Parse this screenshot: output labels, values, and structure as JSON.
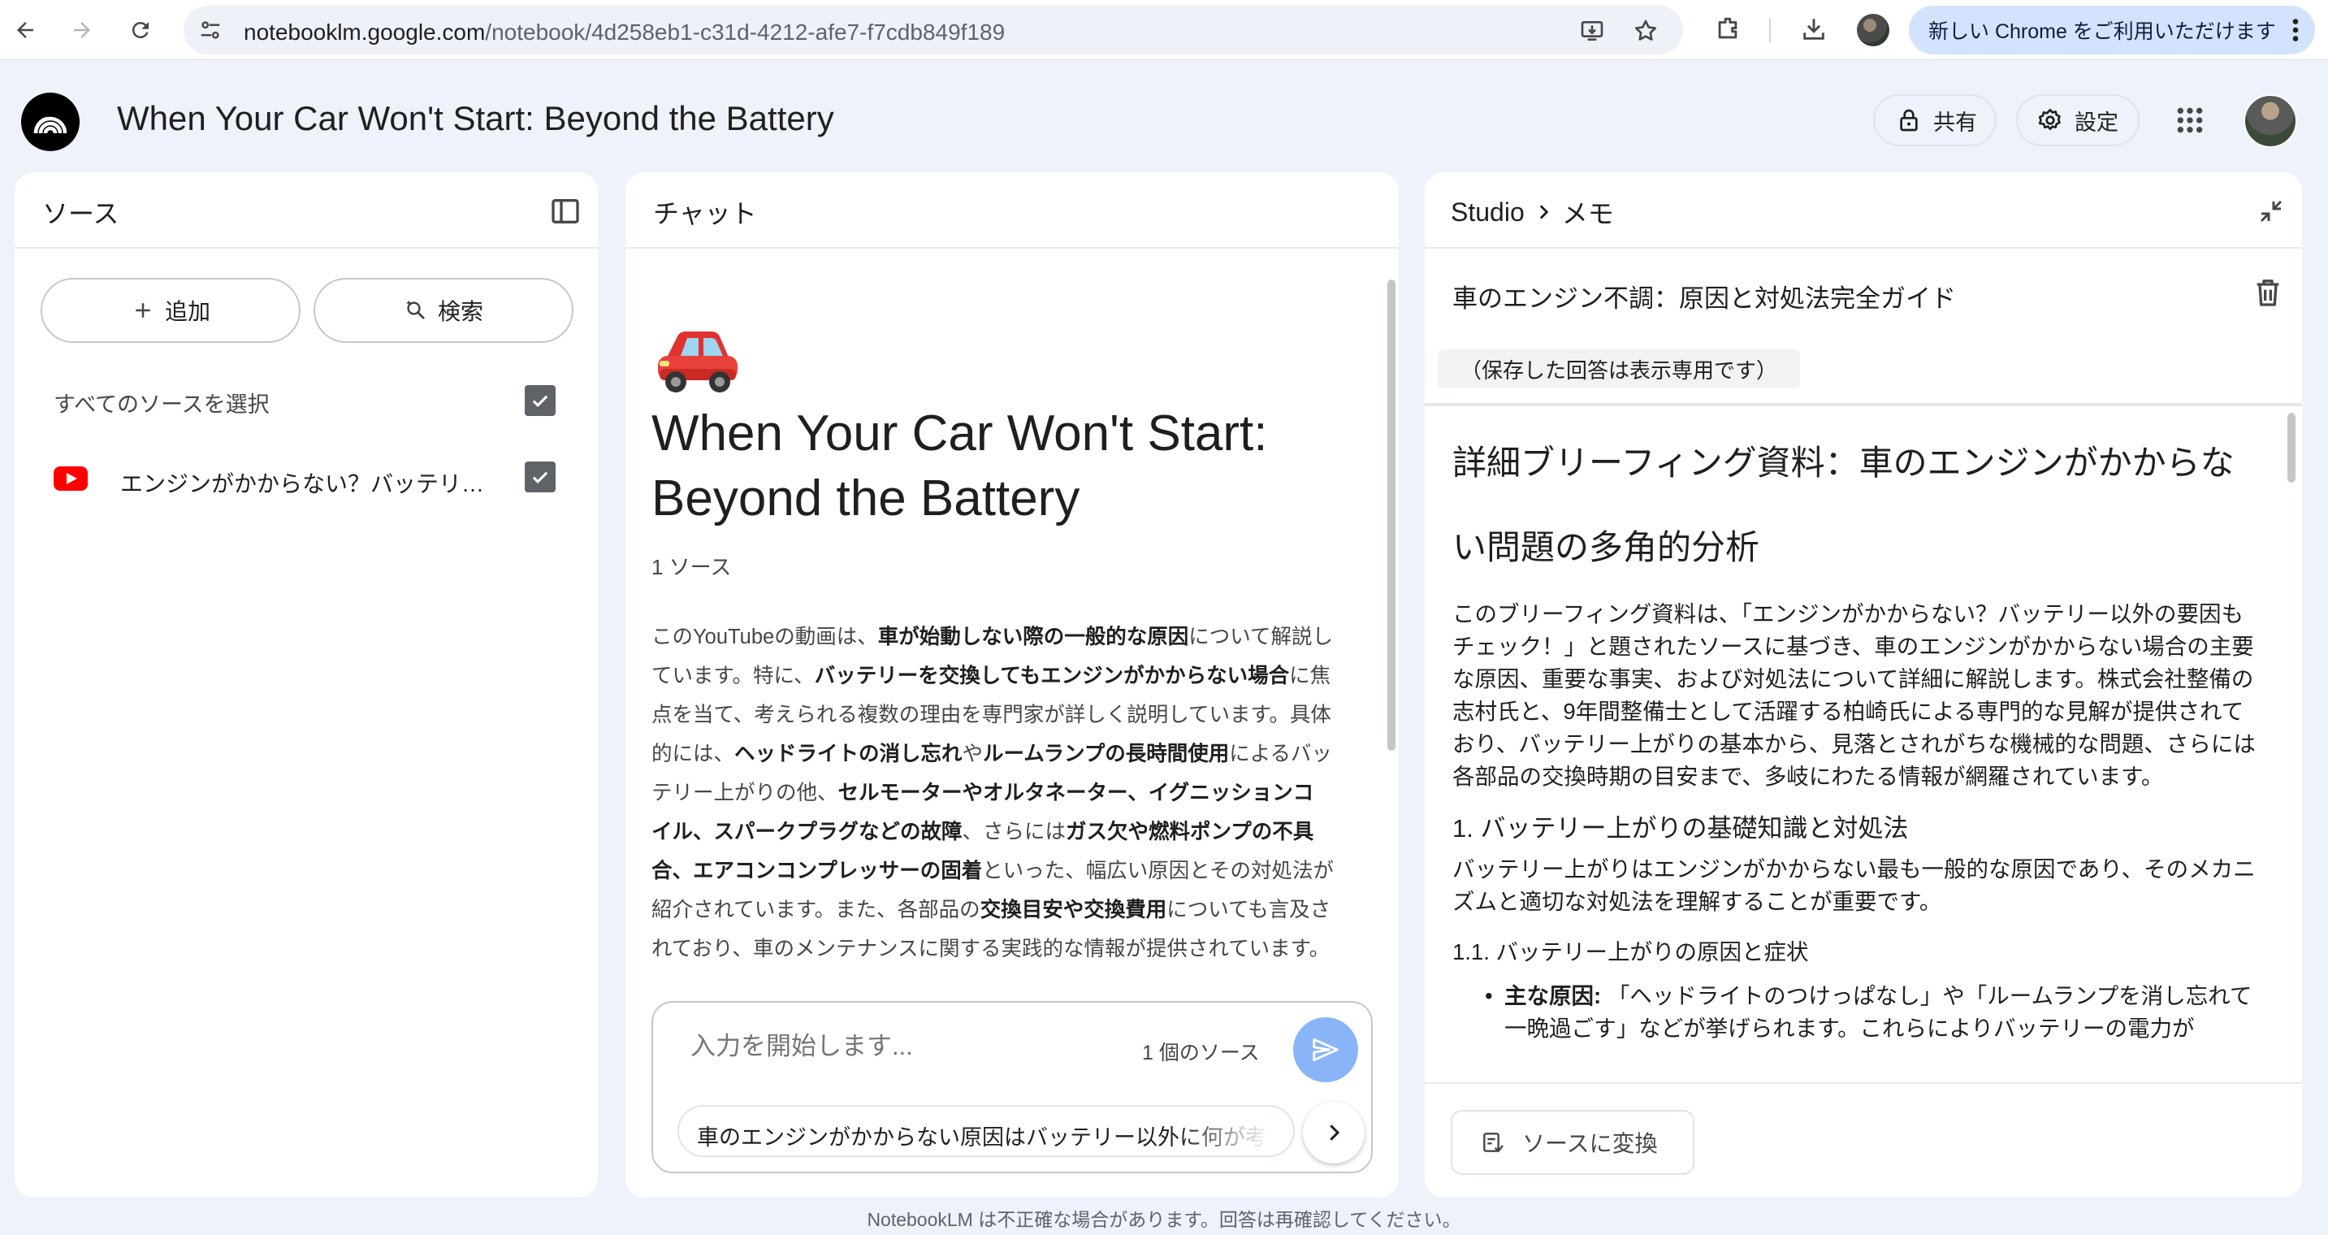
{
  "browser": {
    "url_host": "notebooklm.google.com",
    "url_path": "/notebook/4d258eb1-c31d-4212-afe7-f7cdb849f189",
    "update_chip": "新しい Chrome をご利用いただけます"
  },
  "header": {
    "notebook_title": "When Your Car Won't Start: Beyond the Battery",
    "share_label": "共有",
    "settings_label": "設定"
  },
  "sources": {
    "title": "ソース",
    "add_label": "追加",
    "search_label": "検索",
    "select_all_label": "すべてのソースを選択",
    "select_all_checked": true,
    "items": [
      {
        "label": "エンジンがかからない？バッテリー以外の要因もチェック！",
        "type": "youtube",
        "checked": true
      }
    ]
  },
  "chat": {
    "title": "チャット",
    "emoji": "🚗",
    "notebook_title": "When Your Car Won't Start: Beyond the Battery",
    "source_count": "1 ソース",
    "summary": [
      {
        "t": "このYouTubeの動画は、"
      },
      {
        "t": "車が始動しない際の一般的な原因",
        "b": true
      },
      {
        "t": "について解説しています。特に、"
      },
      {
        "t": "バッテリーを交換してもエンジンがかからない場合",
        "b": true
      },
      {
        "t": "に焦点を当て、考えられる複数の理由を専門家が詳しく説明しています。具体的には、"
      },
      {
        "t": "ヘッドライトの消し忘れ",
        "b": true
      },
      {
        "t": "や"
      },
      {
        "t": "ルームランプの長時間使用",
        "b": true
      },
      {
        "t": "によるバッテリー上がりの他、"
      },
      {
        "t": "セルモーターやオルタネーター、イグニッションコイル、スパークプラグなどの故障",
        "b": true
      },
      {
        "t": "、さらには"
      },
      {
        "t": "ガス欠や燃料ポンプの不具合、エアコンコンプレッサーの固着",
        "b": true
      },
      {
        "t": "といった、幅広い原因とその対処法が紹介されています。また、各部品の"
      },
      {
        "t": "交換目安や交換費用",
        "b": true
      },
      {
        "t": "についても言及されており、車のメンテナンスに関する実践的な情報が提供されています。"
      }
    ],
    "input_placeholder": "入力を開始します...",
    "input_source_count": "1 個のソース",
    "suggestion": "車のエンジンがかからない原因はバッテリー以外に何が考えられますか？"
  },
  "studio": {
    "breadcrumb_root": "Studio",
    "breadcrumb_current": "メモ",
    "note_title": "車のエンジン不調：原因と対処法完全ガイド",
    "readonly_note": "（保存した回答は表示専用です）",
    "note": {
      "h1": "詳細ブリーフィング資料：車のエンジンがかからない問題の多角的分析",
      "intro": "このブリーフィング資料は、「エンジンがかからない？バッテリー以外の要因もチェック！」と題されたソースに基づき、車のエンジンがかからない場合の主要な原因、重要な事実、および対処法について詳細に解説します。株式会社整備の志村氏と、9年間整備士として活躍する柏崎氏による専門的な見解が提供されており、バッテリー上がりの基本から、見落とされがちな機械的な問題、さらには各部品の交換時期の目安まで、多岐にわたる情報が網羅されています。",
      "h2": "1. バッテリー上がりの基礎知識と対処法",
      "p2": "バッテリー上がりはエンジンがかからない最も一般的な原因であり、そのメカニズムと適切な対処法を理解することが重要です。",
      "h3": "1.1. バッテリー上がりの原因と症状",
      "bullet_label": "主な原因:",
      "bullet_text": "「ヘッドライトのつけっぱなし」や「ルームランプを消し忘れて一晩過ごす」などが挙げられます。これらによりバッテリーの電力が"
    },
    "convert_label": "ソースに変換"
  },
  "footer": {
    "disclaimer": "NotebookLM は不正確な場合があります。回答は再確認してください。"
  }
}
